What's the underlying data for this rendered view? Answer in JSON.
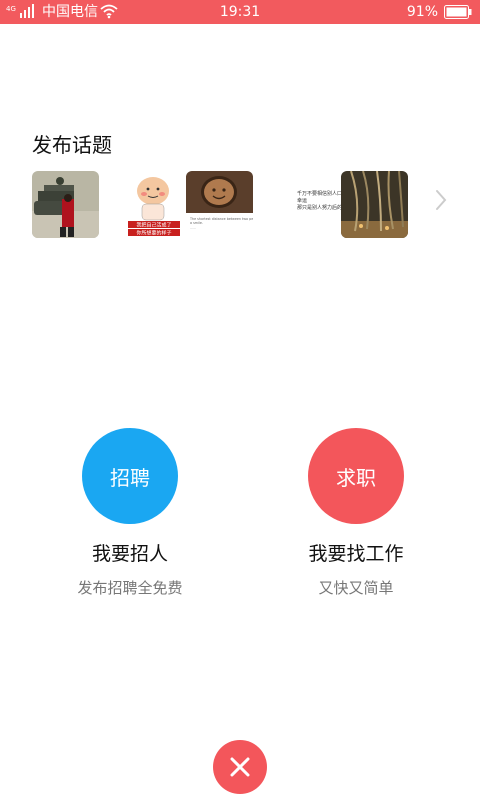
{
  "status_bar": {
    "network": "4G",
    "carrier": "中国电信",
    "time": "19:31",
    "battery": "91%"
  },
  "topics": {
    "title": "发布话题",
    "items": [
      {
        "name": "tank-photo",
        "caption": ""
      },
      {
        "name": "cartoon-pig",
        "caption": "我把自己活成了你所想要的样子"
      },
      {
        "name": "coffee-face",
        "caption": "The shortest distance between two people is a smile."
      },
      {
        "name": "text-card",
        "lines": [
          "千万不要相信别人口中的",
          "幸运",
          "那只是别人努力后的谦虚"
        ]
      },
      {
        "name": "willow-night",
        "caption": ""
      }
    ]
  },
  "actions": [
    {
      "circle_label": "招聘",
      "title": "我要招人",
      "subtitle": "发布招聘全免费",
      "color": "#1aa7f2"
    },
    {
      "circle_label": "求职",
      "title": "我要找工作",
      "subtitle": "又快又简单",
      "color": "#f3565b"
    }
  ]
}
